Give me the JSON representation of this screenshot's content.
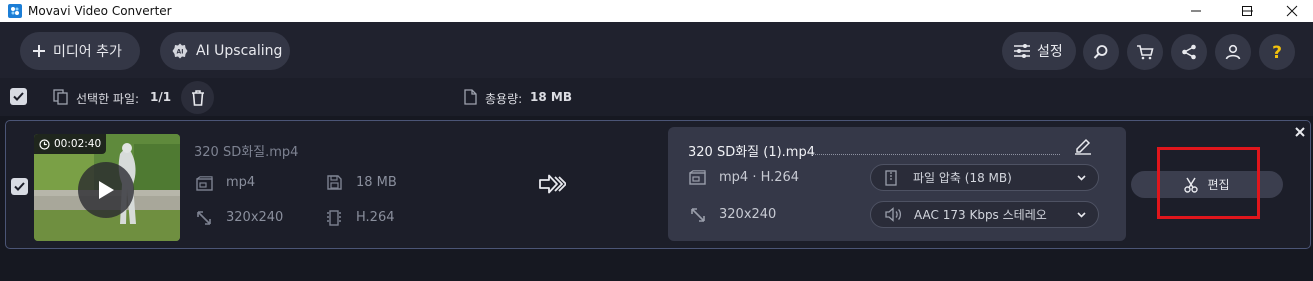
{
  "window": {
    "title": "Movavi Video Converter"
  },
  "toolbar": {
    "add_media_label": "미디어 추가",
    "ai_upscaling_label": "AI Upscaling",
    "settings_label": "설정"
  },
  "selection_bar": {
    "selected_label": "선택한 파일:",
    "selected_count": "1/1",
    "total_size_label": "총용량:",
    "total_size_value": "18 MB"
  },
  "item": {
    "duration": "00:02:40",
    "source": {
      "filename": "320 SD화질.mp4",
      "format": "mp4",
      "size": "18 MB",
      "resolution": "320x240",
      "codec": "H.264"
    },
    "output": {
      "filename": "320 SD화질 (1).mp4",
      "format_codec": "mp4 · H.264",
      "resolution": "320x240",
      "compression_option": "파일 압축 (18 MB)",
      "audio_option": "AAC 173 Kbps 스테레오"
    },
    "edit_label": "편집"
  },
  "colors": {
    "accent_yellow": "#f3c20c",
    "highlight_red": "#e0161c",
    "panel_bg": "#353848"
  },
  "icons": [
    "app-icon",
    "plus-icon",
    "ai-chip-icon",
    "sliders-icon",
    "search-icon",
    "cart-icon",
    "share-icon",
    "user-icon",
    "help-icon",
    "checkbox-icon",
    "files-icon",
    "trash-icon",
    "file-icon",
    "clock-icon",
    "play-icon",
    "video-format-icon",
    "save-icon",
    "resize-icon",
    "codec-icon",
    "convert-arrow-icon",
    "pencil-icon",
    "compress-icon",
    "audio-icon",
    "chevron-down-icon",
    "scissors-icon",
    "close-icon"
  ]
}
